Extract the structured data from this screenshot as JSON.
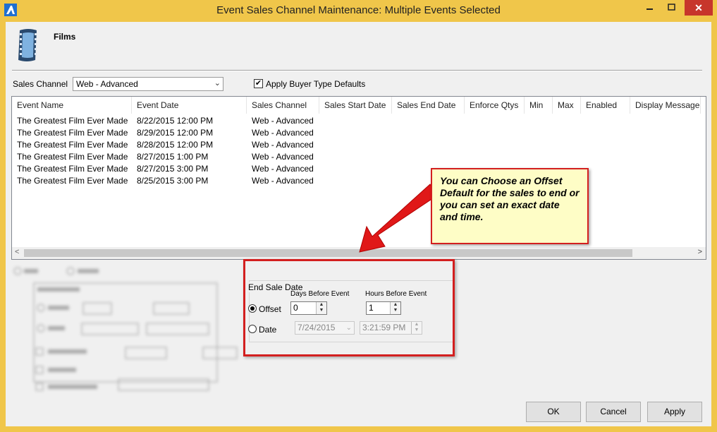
{
  "window": {
    "title": "Event Sales Channel Maintenance: Multiple Events Selected",
    "close_glyph": "✕",
    "minimize_glyph": "–",
    "maximize_glyph": "□"
  },
  "header": {
    "section_label": "Films",
    "icon": "film-strip-icon"
  },
  "sales_channel": {
    "label": "Sales Channel",
    "value": "Web - Advanced",
    "apply_buyer_type_defaults_label": "Apply Buyer Type Defaults",
    "apply_buyer_type_defaults_checked": true
  },
  "grid": {
    "columns": [
      "Event Name",
      "Event Date",
      "Sales Channel",
      "Sales Start Date",
      "Sales End Date",
      "Enforce Qtys",
      "Min",
      "Max",
      "Enabled",
      "Display Message"
    ],
    "rows": [
      [
        "The Greatest Film Ever Made",
        "8/22/2015 12:00 PM",
        "Web - Advanced"
      ],
      [
        "The Greatest Film Ever Made",
        "8/29/2015 12:00 PM",
        "Web - Advanced"
      ],
      [
        "The Greatest Film Ever Made",
        "8/28/2015 12:00 PM",
        "Web - Advanced"
      ],
      [
        "The Greatest Film Ever Made",
        "8/27/2015 1:00 PM",
        "Web - Advanced"
      ],
      [
        "The Greatest Film Ever Made",
        "8/27/2015 3:00 PM",
        "Web - Advanced"
      ],
      [
        "The Greatest Film Ever Made",
        "8/25/2015 3:00 PM",
        "Web - Advanced"
      ]
    ]
  },
  "end_sale_date": {
    "title": "End Sale Date",
    "days_before_event_label": "Days Before Event",
    "hours_before_event_label": "Hours Before Event",
    "offset_label": "Offset",
    "date_label": "Date",
    "offset_selected": true,
    "days_value": "0",
    "hours_value": "1",
    "date_value": "7/24/2015",
    "time_value": "3:21:59 PM"
  },
  "callout": {
    "text": "You can Choose an Offset Default for the sales to end or you can set an exact date and time.",
    "border_color": "#d31f1f",
    "background": "#fefdc6"
  },
  "buttons": {
    "ok": "OK",
    "cancel": "Cancel",
    "apply": "Apply"
  },
  "colors": {
    "window_frame": "#f0c64a",
    "client_bg": "#f0f0f0",
    "close_button": "#c7362b"
  }
}
